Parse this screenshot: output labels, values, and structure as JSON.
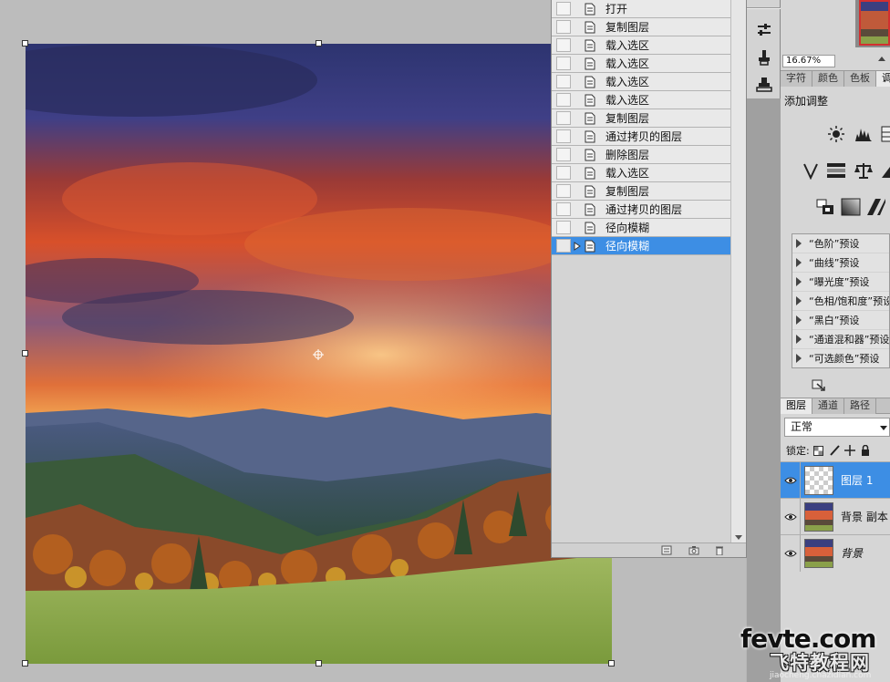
{
  "history": {
    "items": [
      {
        "label": "打开",
        "active": false
      },
      {
        "label": "复制图层",
        "active": false
      },
      {
        "label": "载入选区",
        "active": false
      },
      {
        "label": "载入选区",
        "active": false
      },
      {
        "label": "载入选区",
        "active": false
      },
      {
        "label": "载入选区",
        "active": false
      },
      {
        "label": "复制图层",
        "active": false
      },
      {
        "label": "通过拷贝的图层",
        "active": false
      },
      {
        "label": "删除图层",
        "active": false
      },
      {
        "label": "载入选区",
        "active": false
      },
      {
        "label": "复制图层",
        "active": false
      },
      {
        "label": "通过拷贝的图层",
        "active": false
      },
      {
        "label": "径向模糊",
        "active": false
      },
      {
        "label": "径向模糊",
        "active": true
      }
    ]
  },
  "navigator": {
    "zoom": "16.67%"
  },
  "adjust_panel": {
    "tabs": [
      {
        "label": "字符",
        "active": false
      },
      {
        "label": "颜色",
        "active": false
      },
      {
        "label": "色板",
        "active": false
      },
      {
        "label": "调",
        "active": true
      }
    ],
    "title": "添加调整",
    "presets": [
      "“色阶”预设",
      "“曲线”预设",
      "“曝光度”预设",
      "“色相/饱和度”预设",
      "“黑白”预设",
      "“通道混和器”预设",
      "“可选颜色”预设"
    ]
  },
  "layers_panel": {
    "tabs": [
      {
        "label": "图层",
        "active": true
      },
      {
        "label": "通道",
        "active": false
      },
      {
        "label": "路径",
        "active": false
      }
    ],
    "blend_mode": "正常",
    "lock_label": "锁定:",
    "layers": [
      {
        "name": "图层 1",
        "selected": true,
        "italic": false,
        "thumb": "transparent"
      },
      {
        "name": "背景 副本",
        "selected": false,
        "italic": false,
        "thumb": "sunset"
      },
      {
        "name": "背景",
        "selected": false,
        "italic": true,
        "thumb": "sunset"
      }
    ]
  },
  "watermark": {
    "main": "fevte.com",
    "cn": "飞特教程网",
    "url": "jiaocheng.chazidian.com"
  },
  "colors": {
    "selection": "#3d8ee4",
    "panel_bg": "#d6d6d6",
    "canvas_bg": "#bcbcbc"
  }
}
